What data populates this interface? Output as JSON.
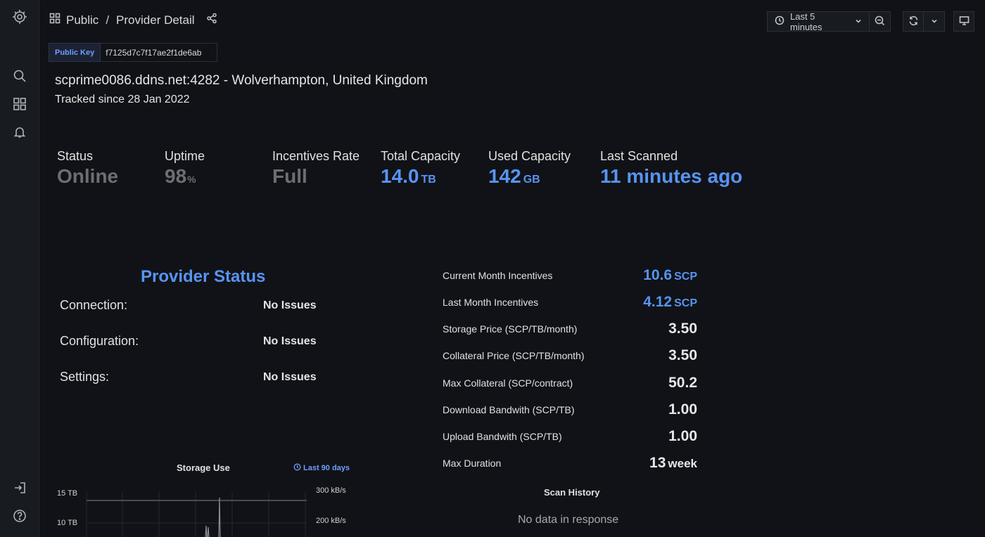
{
  "sidenav": {
    "items": [
      {
        "icon": "grafana-logo-icon"
      },
      {
        "icon": "search-icon"
      },
      {
        "icon": "dashboards-icon"
      },
      {
        "icon": "bell-icon"
      },
      {
        "icon": "sign-in-icon"
      },
      {
        "icon": "help-icon"
      }
    ]
  },
  "breadcrumb": {
    "folder": "Public",
    "separator": "/",
    "dashboard": "Provider Detail"
  },
  "toolbar": {
    "time_range": "Last 5 minutes"
  },
  "public_key": {
    "label": "Public Key",
    "value": "f7125d7c7f17ae2f1de6ab"
  },
  "host": {
    "address": "scprime0086.ddns.net:4282 - Wolverhampton, United Kingdom",
    "tracked": "Tracked since 28 Jan 2022"
  },
  "stats": [
    {
      "title": "Status",
      "value": "Online",
      "unit": "",
      "color": "#6d6e72"
    },
    {
      "title": "Uptime",
      "value": "98",
      "unit": "%",
      "color": "#6d6e72"
    },
    {
      "title": "Incentives Rate",
      "value": "Full",
      "unit": "",
      "color": "#6d6e72"
    },
    {
      "title": "Total Capacity",
      "value": "14.0",
      "unit": "TB",
      "color": "#5794f2"
    },
    {
      "title": "Used Capacity",
      "value": "142",
      "unit": "GB",
      "color": "#5794f2"
    },
    {
      "title": "Last Scanned",
      "value": "11 minutes ago",
      "unit": "",
      "color": "#5794f2"
    }
  ],
  "provider_status": {
    "title": "Provider Status",
    "rows": [
      {
        "label": "Connection:",
        "value": "No Issues"
      },
      {
        "label": "Configuration:",
        "value": "No Issues"
      },
      {
        "label": "Settings:",
        "value": "No Issues"
      }
    ]
  },
  "incentives": [
    {
      "label": "Current Month Incentives",
      "value": "10.6",
      "unit": "SCP"
    },
    {
      "label": "Last Month Incentives",
      "value": "4.12",
      "unit": "SCP"
    },
    {
      "label": "Storage Price (SCP/TB/month)",
      "value": "3.50",
      "unit": ""
    },
    {
      "label": "Collateral Price (SCP/TB/month)",
      "value": "3.50",
      "unit": ""
    },
    {
      "label": "Max Collateral (SCP/contract)",
      "value": "50.2",
      "unit": ""
    },
    {
      "label": "Download Bandwith (SCP/TB)",
      "value": "1.00",
      "unit": ""
    },
    {
      "label": "Upload Bandwith (SCP/TB)",
      "value": "1.00",
      "unit": ""
    },
    {
      "label": "Max Duration",
      "value": "13",
      "unit": "week"
    }
  ],
  "storage_use": {
    "title": "Storage Use",
    "range": "Last 90 days",
    "left_axis": [
      "15 TB",
      "10 TB"
    ],
    "right_axis": [
      "300 kB/s",
      "200 kB/s"
    ]
  },
  "scan_history": {
    "title": "Scan History",
    "empty": "No data in response"
  }
}
